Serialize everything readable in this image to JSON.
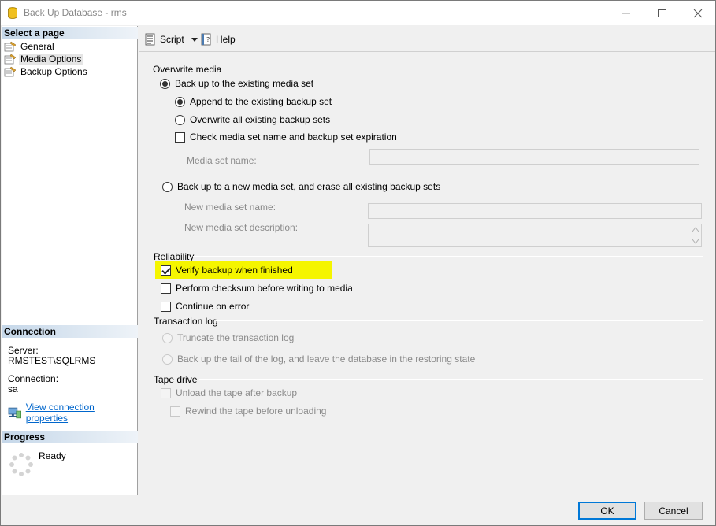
{
  "window": {
    "title": "Back Up Database - rms"
  },
  "left": {
    "select_page_header": "Select a page",
    "pages": [
      {
        "label": "General"
      },
      {
        "label": "Media Options"
      },
      {
        "label": "Backup Options"
      }
    ],
    "connection_header": "Connection",
    "server_label": "Server:",
    "server_value": "RMSTEST\\SQLRMS",
    "connection_label": "Connection:",
    "connection_value": "sa",
    "view_connection_link": "View connection properties",
    "progress_header": "Progress",
    "progress_status": "Ready"
  },
  "toolbar": {
    "script_label": "Script",
    "help_label": "Help"
  },
  "overwrite_media": {
    "group_label": "Overwrite media",
    "backup_existing": "Back up to the existing media set",
    "append": "Append to the existing backup set",
    "overwrite_all": "Overwrite all existing backup sets",
    "check_media": "Check media set name and backup set expiration",
    "media_set_name_label": "Media set name:",
    "backup_new": "Back up to a new media set, and erase all existing backup sets",
    "new_media_name_label": "New media set name:",
    "new_media_desc_label": "New media set description:"
  },
  "reliability": {
    "group_label": "Reliability",
    "verify": "Verify backup when finished",
    "checksum": "Perform checksum before writing to media",
    "continue_on_error": "Continue on error"
  },
  "transaction_log": {
    "group_label": "Transaction log",
    "truncate": "Truncate the transaction log",
    "tail": "Back up the tail of the log, and leave the database in the restoring state"
  },
  "tape_drive": {
    "group_label": "Tape drive",
    "unload": "Unload the tape after backup",
    "rewind": "Rewind the tape before unloading"
  },
  "buttons": {
    "ok": "OK",
    "cancel": "Cancel"
  },
  "colors": {
    "highlight": "#f5f500",
    "link": "#0066cc",
    "header_gradient": "#c5d7e9",
    "default_button_border": "#0078d7"
  }
}
